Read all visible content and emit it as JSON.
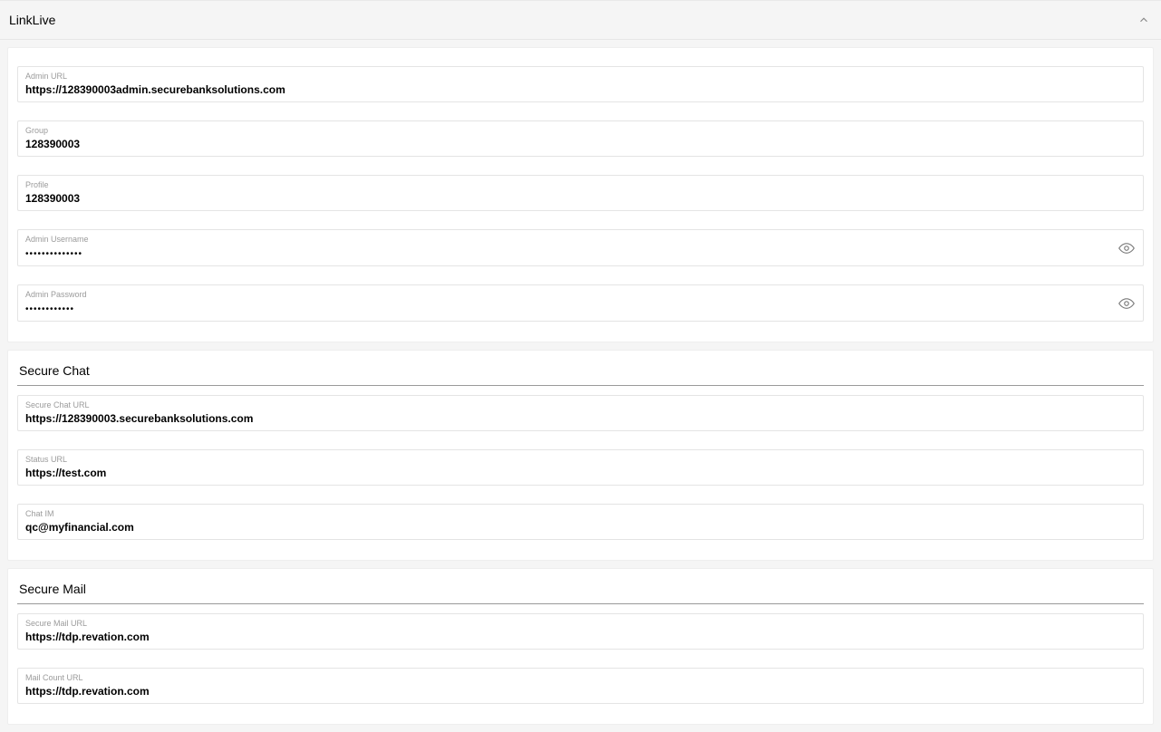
{
  "panel": {
    "title": "LinkLive"
  },
  "linklive": {
    "admin_url": {
      "label": "Admin URL",
      "value": "https://128390003admin.securebanksolutions.com"
    },
    "group": {
      "label": "Group",
      "value": "128390003"
    },
    "profile": {
      "label": "Profile",
      "value": "128390003"
    },
    "admin_username": {
      "label": "Admin Username",
      "value": "••••••••••••••"
    },
    "admin_password": {
      "label": "Admin Password",
      "value": "••••••••••••"
    }
  },
  "secure_chat": {
    "title": "Secure Chat",
    "secure_chat_url": {
      "label": "Secure Chat URL",
      "value": "https://128390003.securebanksolutions.com"
    },
    "status_url": {
      "label": "Status URL",
      "value": "https://test.com"
    },
    "chat_im": {
      "label": "Chat IM",
      "value": "qc@myfinancial.com"
    }
  },
  "secure_mail": {
    "title": "Secure Mail",
    "secure_mail_url": {
      "label": "Secure Mail URL",
      "value": "https://tdp.revation.com"
    },
    "mail_count_url": {
      "label": "Mail Count URL",
      "value": "https://tdp.revation.com"
    }
  }
}
